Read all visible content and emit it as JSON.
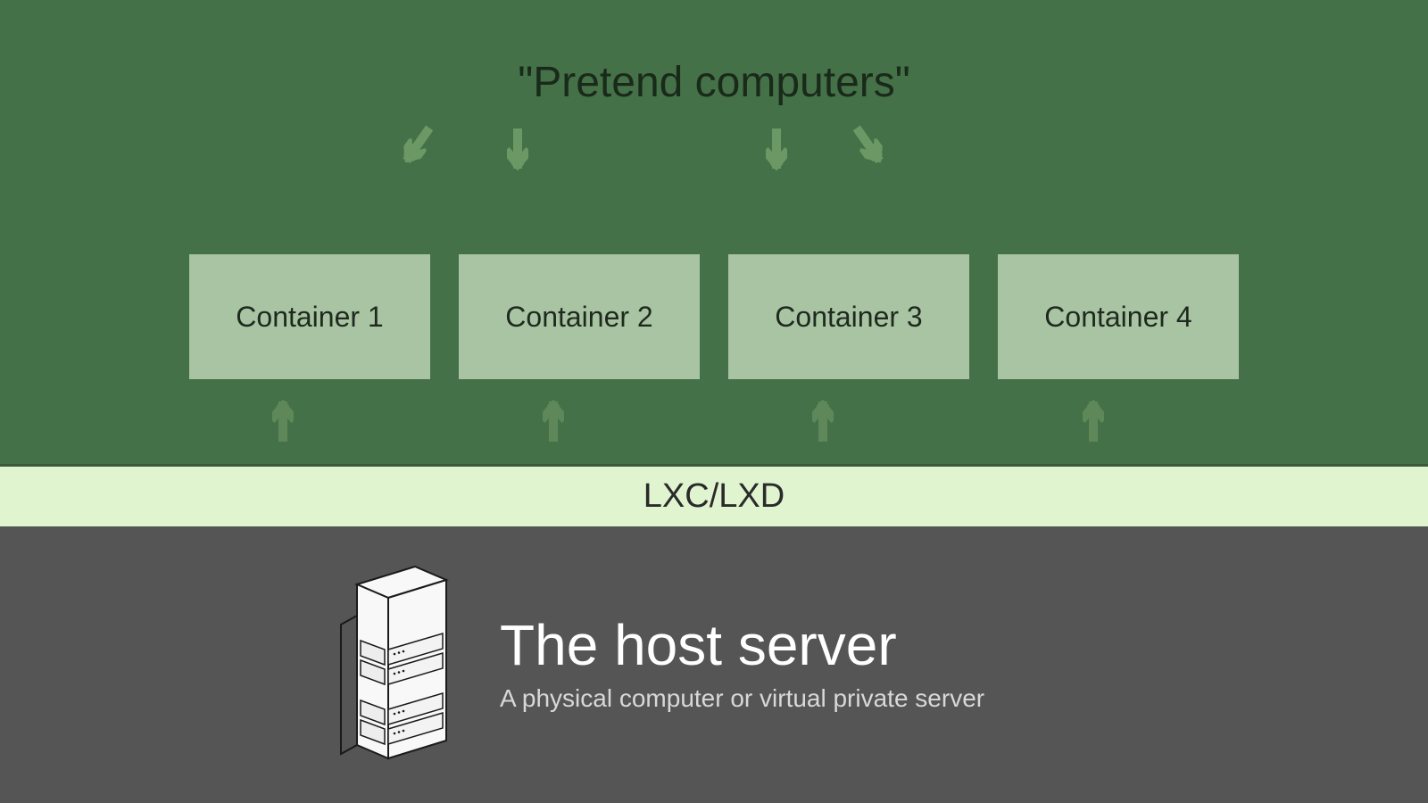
{
  "title": "\"Pretend computers\"",
  "containers": [
    {
      "label": "Container 1"
    },
    {
      "label": "Container 2"
    },
    {
      "label": "Container 3"
    },
    {
      "label": "Container 4"
    }
  ],
  "middleware": "LXC/LXD",
  "host": {
    "title": "The host server",
    "subtitle": "A physical computer or virtual private server"
  },
  "colors": {
    "topBg": "#457148",
    "containerBg": "#a9c4a3",
    "lxcBg": "#dff4cf",
    "hostBg": "#555555",
    "arrow": "#6b9865"
  }
}
